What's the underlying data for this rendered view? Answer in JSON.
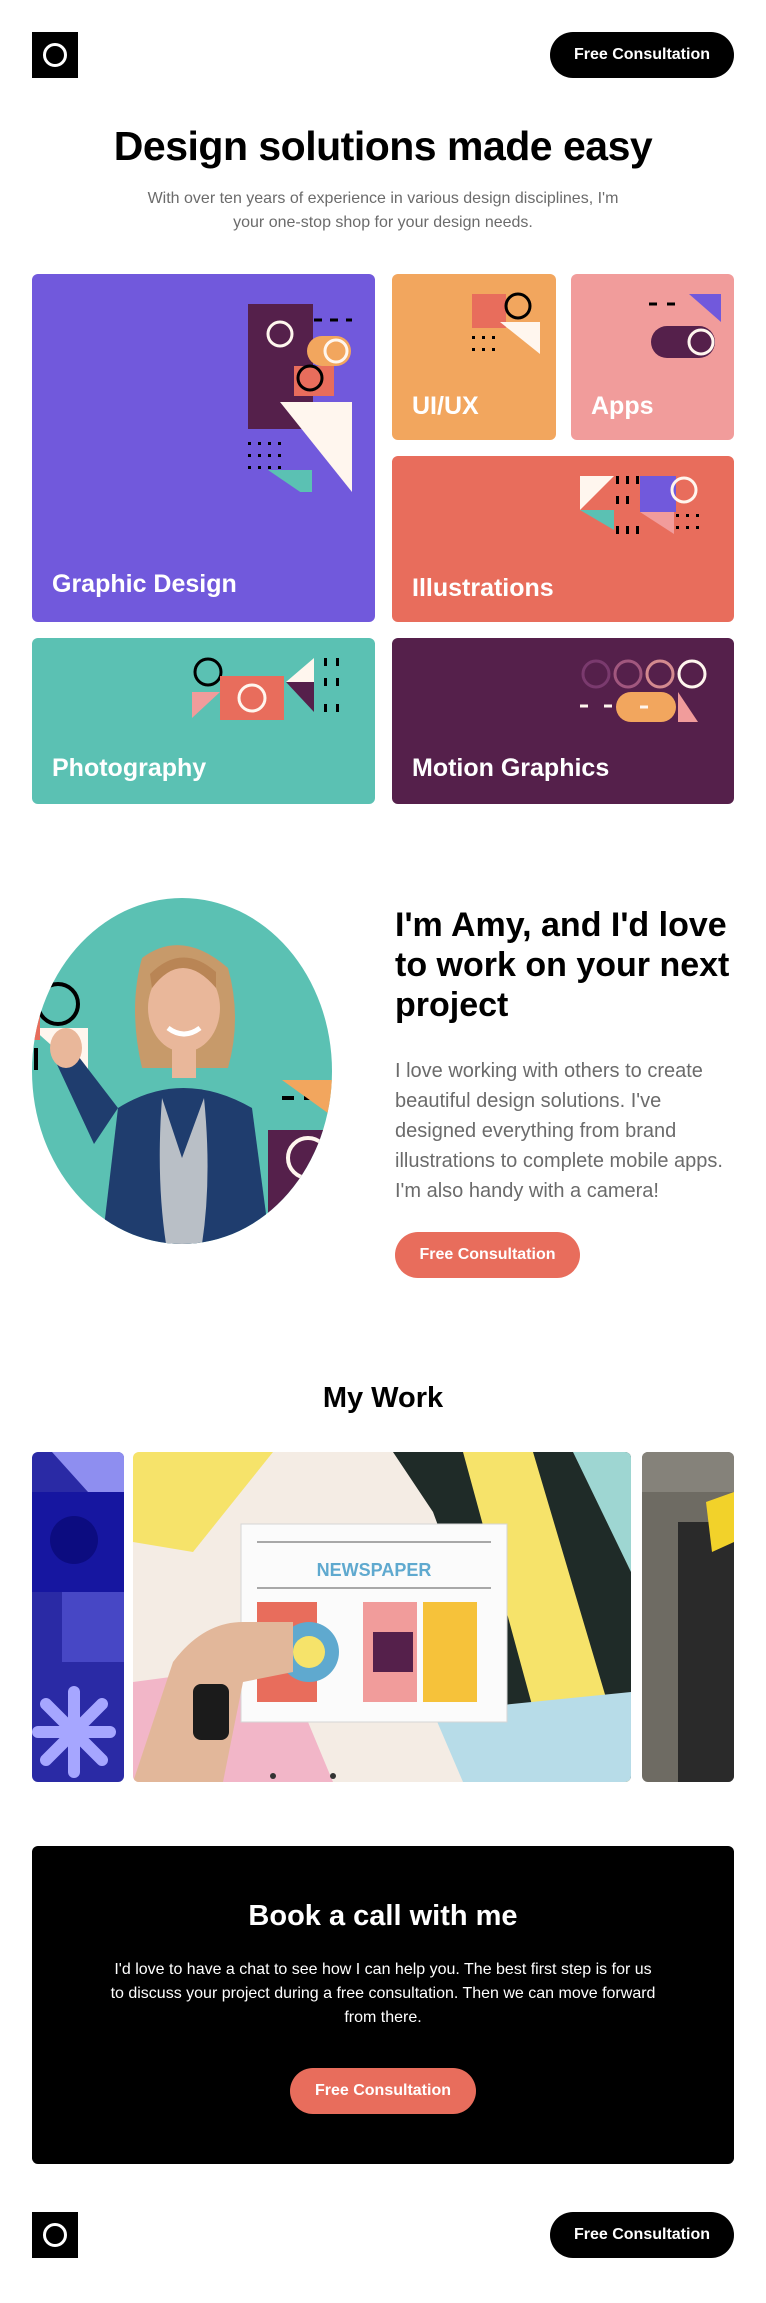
{
  "header": {
    "cta_label": "Free Consultation"
  },
  "hero": {
    "title": "Design solutions made easy",
    "subtitle": "With over ten years of experience in various design disciplines, I'm your one-stop shop for your design needs."
  },
  "services": [
    {
      "label": "Graphic Design"
    },
    {
      "label": "UI/UX"
    },
    {
      "label": "Apps"
    },
    {
      "label": "Illustrations"
    },
    {
      "label": "Photography"
    },
    {
      "label": "Motion Graphics"
    }
  ],
  "about": {
    "title": "I'm Amy, and I'd love to work on your next project",
    "text": "I love working with others to create beautiful design solutions. I've designed everything from brand illustrations to complete mobile apps. I'm also handy with a camera!",
    "cta_label": "Free Consultation"
  },
  "work": {
    "title": "My Work",
    "newspaper_title": "NEWSPAPER"
  },
  "cta": {
    "title": "Book a call with me",
    "text": "I'd love to have a chat to see how I can help you. The best first step is for us to discuss your project during a free consultation. Then we can move forward from there.",
    "button_label": "Free Consultation"
  },
  "footer": {
    "cta_label": "Free Consultation"
  },
  "colors": {
    "purple": "#7159dc",
    "orange": "#f2a65e",
    "pink": "#f19c9b",
    "coral": "#e86d5c",
    "teal": "#5bc1b3",
    "plum": "#55204b",
    "cream": "#fff6ee",
    "black": "#000000"
  }
}
